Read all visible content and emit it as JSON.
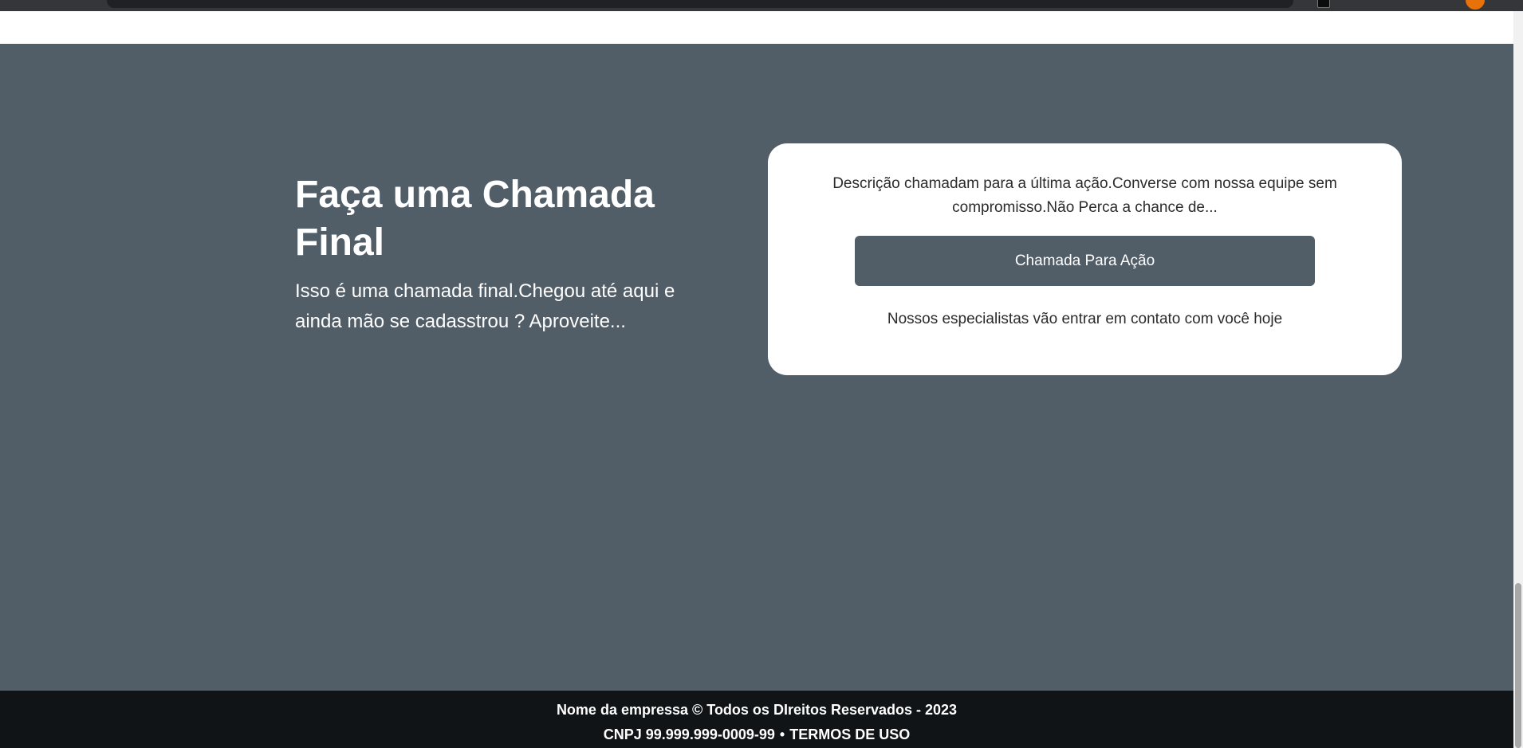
{
  "cta": {
    "title": "Faça uma Chamada Final",
    "subtitle": "Isso é uma chamada final.Chegou até aqui e ainda mão se cadasstrou ? Aproveite...",
    "card": {
      "description": "Descrição chamadam para a última ação.Converse com nossa equipe sem compromisso.Não Perca a chance de...",
      "button_label": "Chamada Para Ação",
      "note": "Nossos especialistas vão entrar em contato com você hoje"
    }
  },
  "footer": {
    "copyright": "Nome da empressa © Todos os DIreitos Reservados - 2023",
    "cnpj": "CNPJ 99.999.999-0009-99",
    "separator": "•",
    "terms_label": "TERMOS DE USO"
  },
  "colors": {
    "section_bg": "#515d67",
    "footer_bg": "#101417",
    "button_bg": "#515d67",
    "card_bg": "#ffffff"
  },
  "icons": {
    "browser_profile": "avatar-icon",
    "browser_extension": "extension-icon"
  }
}
